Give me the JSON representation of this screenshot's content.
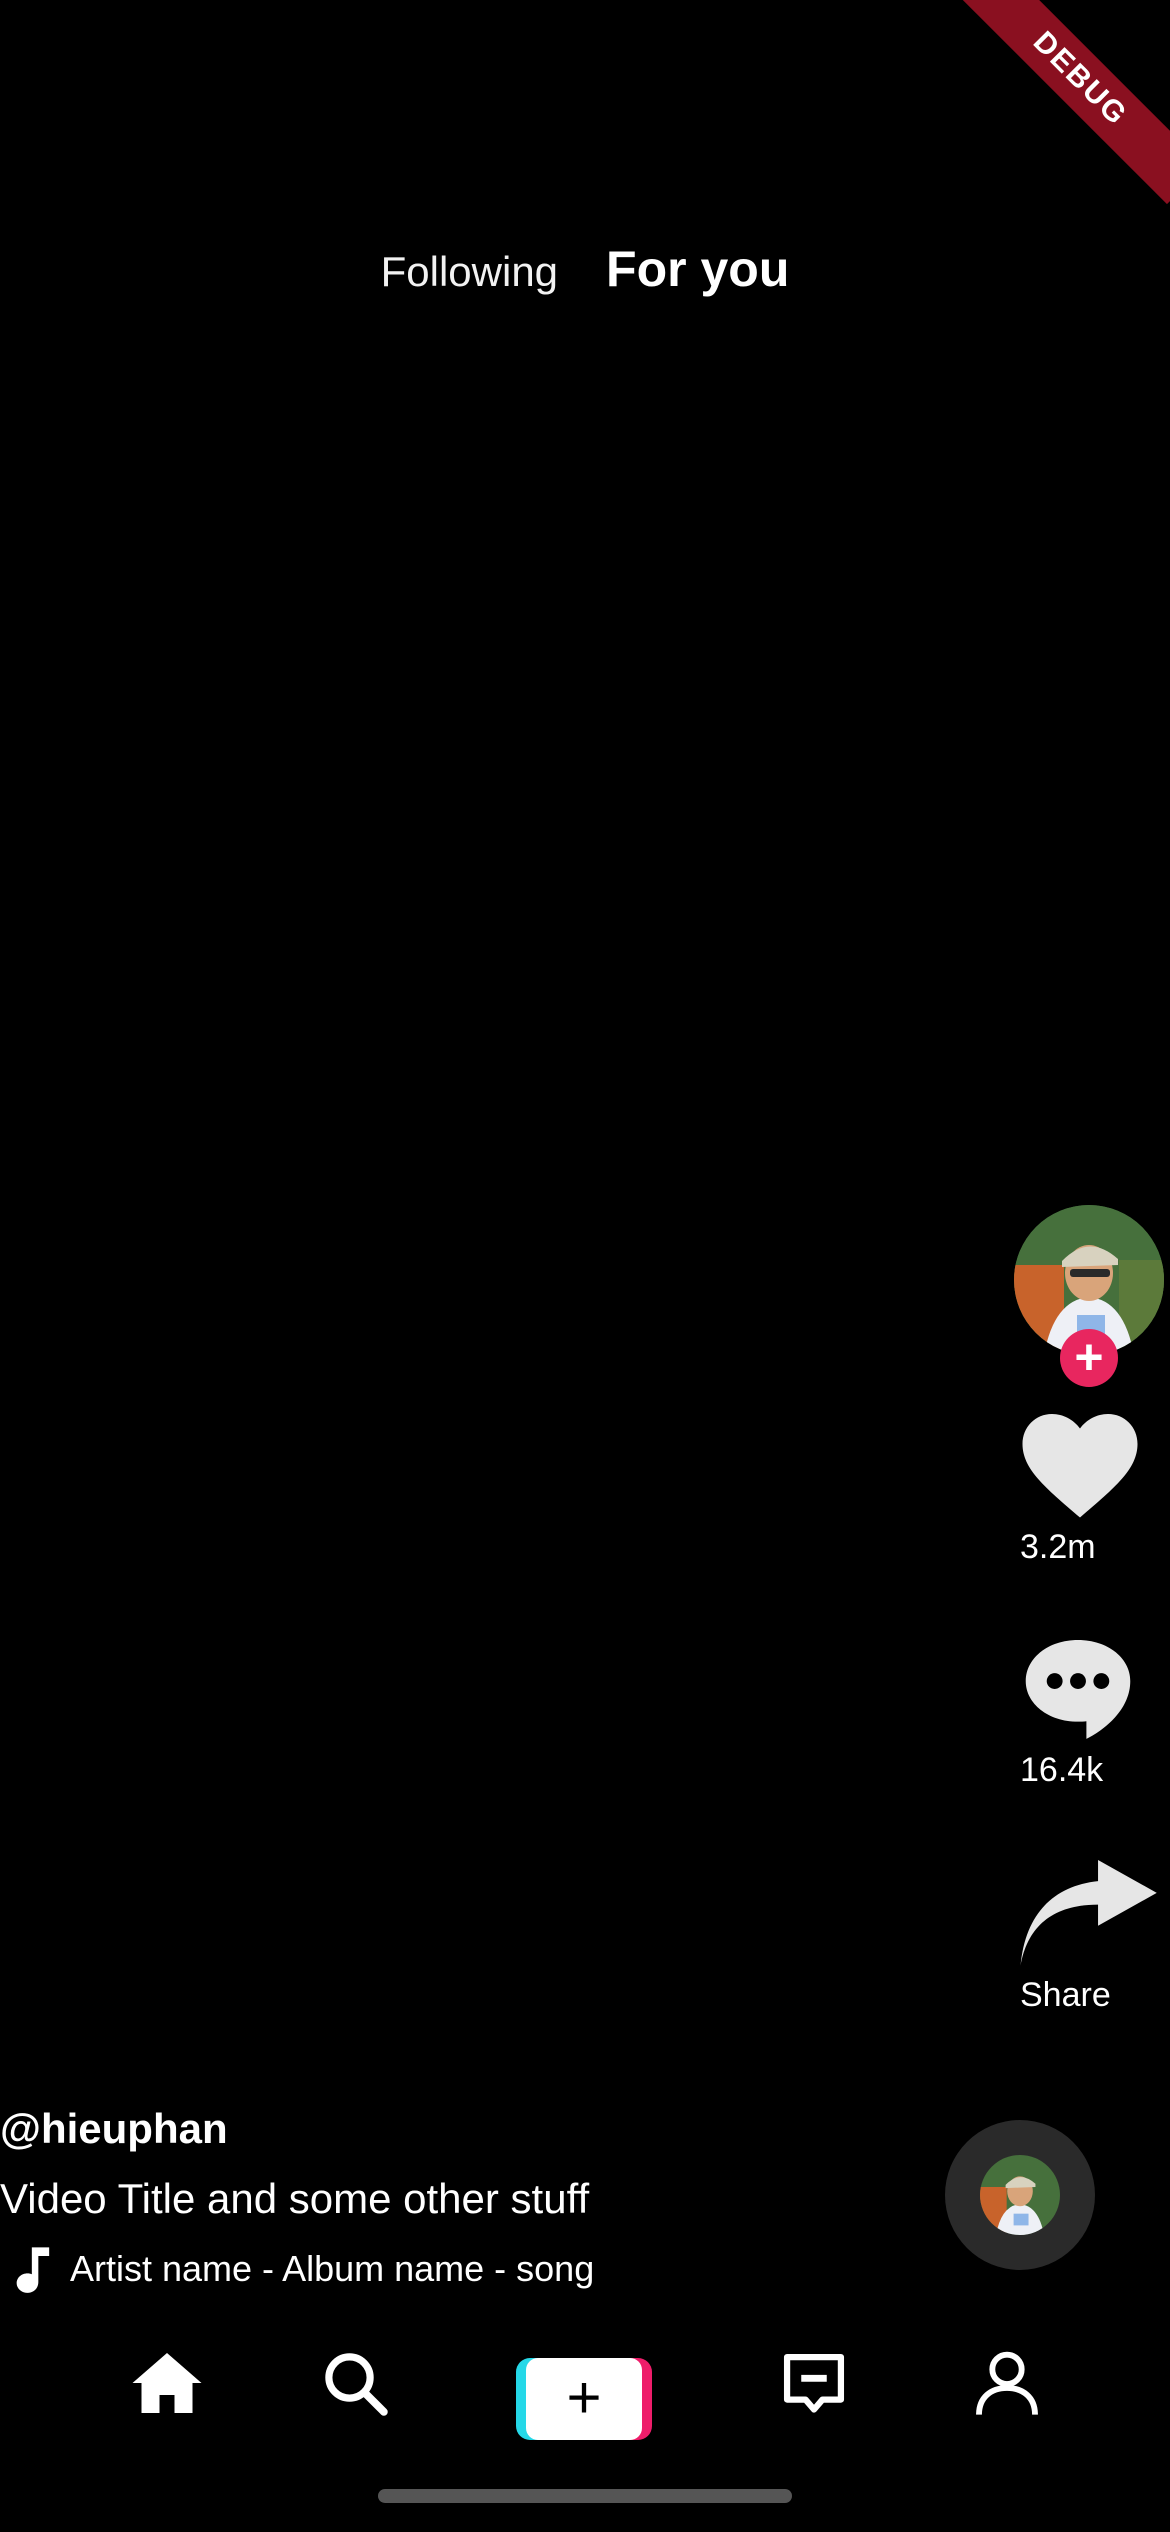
{
  "debug_banner": "DEBUG",
  "tabs": {
    "following": "Following",
    "for_you": "For you"
  },
  "actions": {
    "likes": "3.2m",
    "comments": "16.4k",
    "share": "Share"
  },
  "video": {
    "username": "@hieuphan",
    "title": "Video Title and some other stuff",
    "music": "Artist name - Album name - song"
  },
  "nav": {
    "items": [
      "home-icon",
      "search-icon",
      "create-icon",
      "inbox-icon",
      "profile-icon"
    ]
  },
  "colors": {
    "background": "#000000",
    "accent_pink": "#ee1d6a",
    "accent_cyan": "#25d8e8",
    "icon_gray": "#e6e6e6"
  }
}
